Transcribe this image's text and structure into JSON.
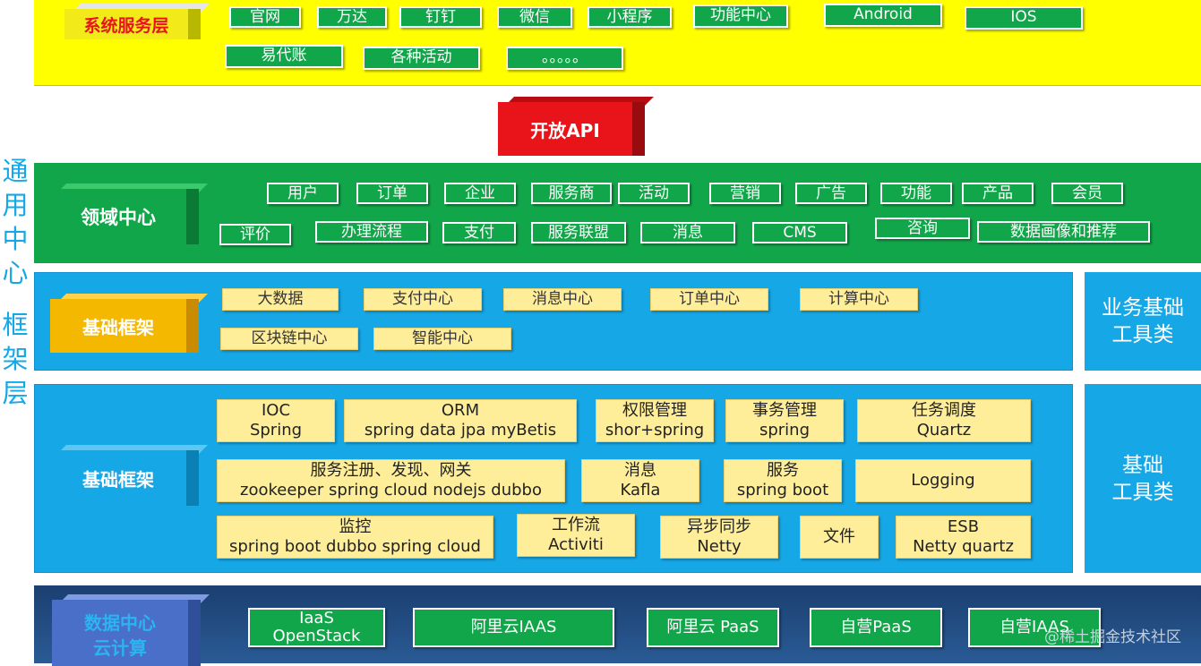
{
  "side_label": [
    "通",
    "用",
    "中",
    "心",
    "",
    "框",
    "架",
    "层"
  ],
  "system_layer": {
    "title": "系统服务层",
    "items": [
      "官网",
      "万达",
      "钉钉",
      "微信",
      "小程序",
      "功能中心",
      "Android",
      "IOS",
      "易代账",
      "各种活动",
      "。。。。。"
    ]
  },
  "open_api": "开放API",
  "domain_center": {
    "title": "领域中心",
    "items": [
      "用户",
      "订单",
      "企业",
      "服务商",
      "活动",
      "营销",
      "广告",
      "功能",
      "产品",
      "会员",
      "评价",
      "办理流程",
      "支付",
      "服务联盟",
      "消息",
      "CMS",
      "咨询",
      "数据画像和推荐"
    ]
  },
  "base_framework_1": {
    "title": "基础框架",
    "items": [
      "大数据",
      "支付中心",
      "消息中心",
      "订单中心",
      "计算中心",
      "区块链中心",
      "智能中心"
    ]
  },
  "business_tools": "业务基础\n工具类",
  "business_tools_lines": [
    "业务基础",
    "工具类"
  ],
  "base_framework_2": {
    "title": "基础框架",
    "items": [
      {
        "l1": "IOC",
        "l2": "Spring"
      },
      {
        "l1": "ORM",
        "l2": "spring data jpa myBetis"
      },
      {
        "l1": "权限管理",
        "l2": "shor+spring"
      },
      {
        "l1": "事务管理",
        "l2": "spring"
      },
      {
        "l1": "任务调度",
        "l2": "Quartz"
      },
      {
        "l1": "服务注册、发现、网关",
        "l2": "zookeeper spring cloud nodejs dubbo"
      },
      {
        "l1": "消息",
        "l2": "Kafla"
      },
      {
        "l1": "服务",
        "l2": "spring boot"
      },
      {
        "l1": "Logging",
        "l2": ""
      },
      {
        "l1": "监控",
        "l2": "spring boot dubbo spring cloud"
      },
      {
        "l1": "工作流",
        "l2": "Activiti"
      },
      {
        "l1": "异步同步",
        "l2": "Netty"
      },
      {
        "l1": "文件",
        "l2": ""
      },
      {
        "l1": "ESB",
        "l2": "Netty quartz"
      }
    ]
  },
  "base_tools_lines": [
    "基础",
    "工具类"
  ],
  "data_center": {
    "title_lines": [
      "数据中心",
      "云计算"
    ],
    "items": [
      {
        "l1": "IaaS",
        "l2": "OpenStack"
      },
      {
        "l1": "阿里云IAAS",
        "l2": ""
      },
      {
        "l1": "阿里云 PaaS",
        "l2": ""
      },
      {
        "l1": "自营PaaS",
        "l2": ""
      },
      {
        "l1": "自营IAAS",
        "l2": ""
      }
    ]
  },
  "watermark": "@稀土掘金技术社区",
  "colors": {
    "yellow": "#ffff00",
    "green": "#12a64a",
    "blue": "#16a7e6",
    "red": "#e8141a",
    "gold": "#f5b800",
    "navy": "#1b3f70"
  }
}
